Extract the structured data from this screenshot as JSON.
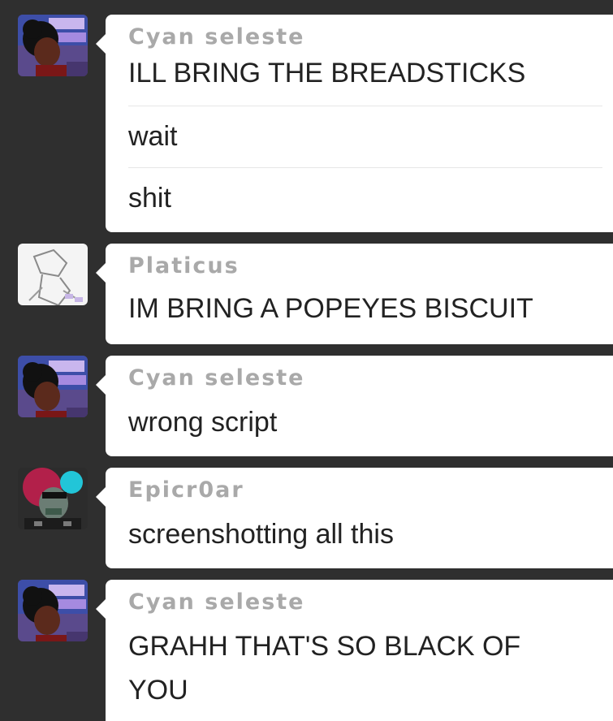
{
  "colors": {
    "background": "#2f2f2f",
    "bubble": "#ffffff",
    "username": "#a9a9a9",
    "text": "#222222"
  },
  "messages": [
    {
      "user": "Cyan seleste",
      "avatar_icon": "cyan-seleste-avatar",
      "lines": [
        "ILL BRING THE BREADSTICKS",
        "wait",
        "shit"
      ]
    },
    {
      "user": "Platicus",
      "avatar_icon": "platicus-avatar",
      "lines": [
        "IM BRING A POPEYES BISCUIT"
      ]
    },
    {
      "user": "Cyan seleste",
      "avatar_icon": "cyan-seleste-avatar",
      "lines": [
        "wrong script"
      ]
    },
    {
      "user": "Epicr0ar",
      "avatar_icon": "epicr0ar-avatar",
      "lines": [
        "screenshotting all this"
      ]
    },
    {
      "user": "Cyan seleste",
      "avatar_icon": "cyan-seleste-avatar",
      "lines": [
        "GRAHH THAT'S SO BLACK OF",
        "YOU"
      ]
    }
  ]
}
